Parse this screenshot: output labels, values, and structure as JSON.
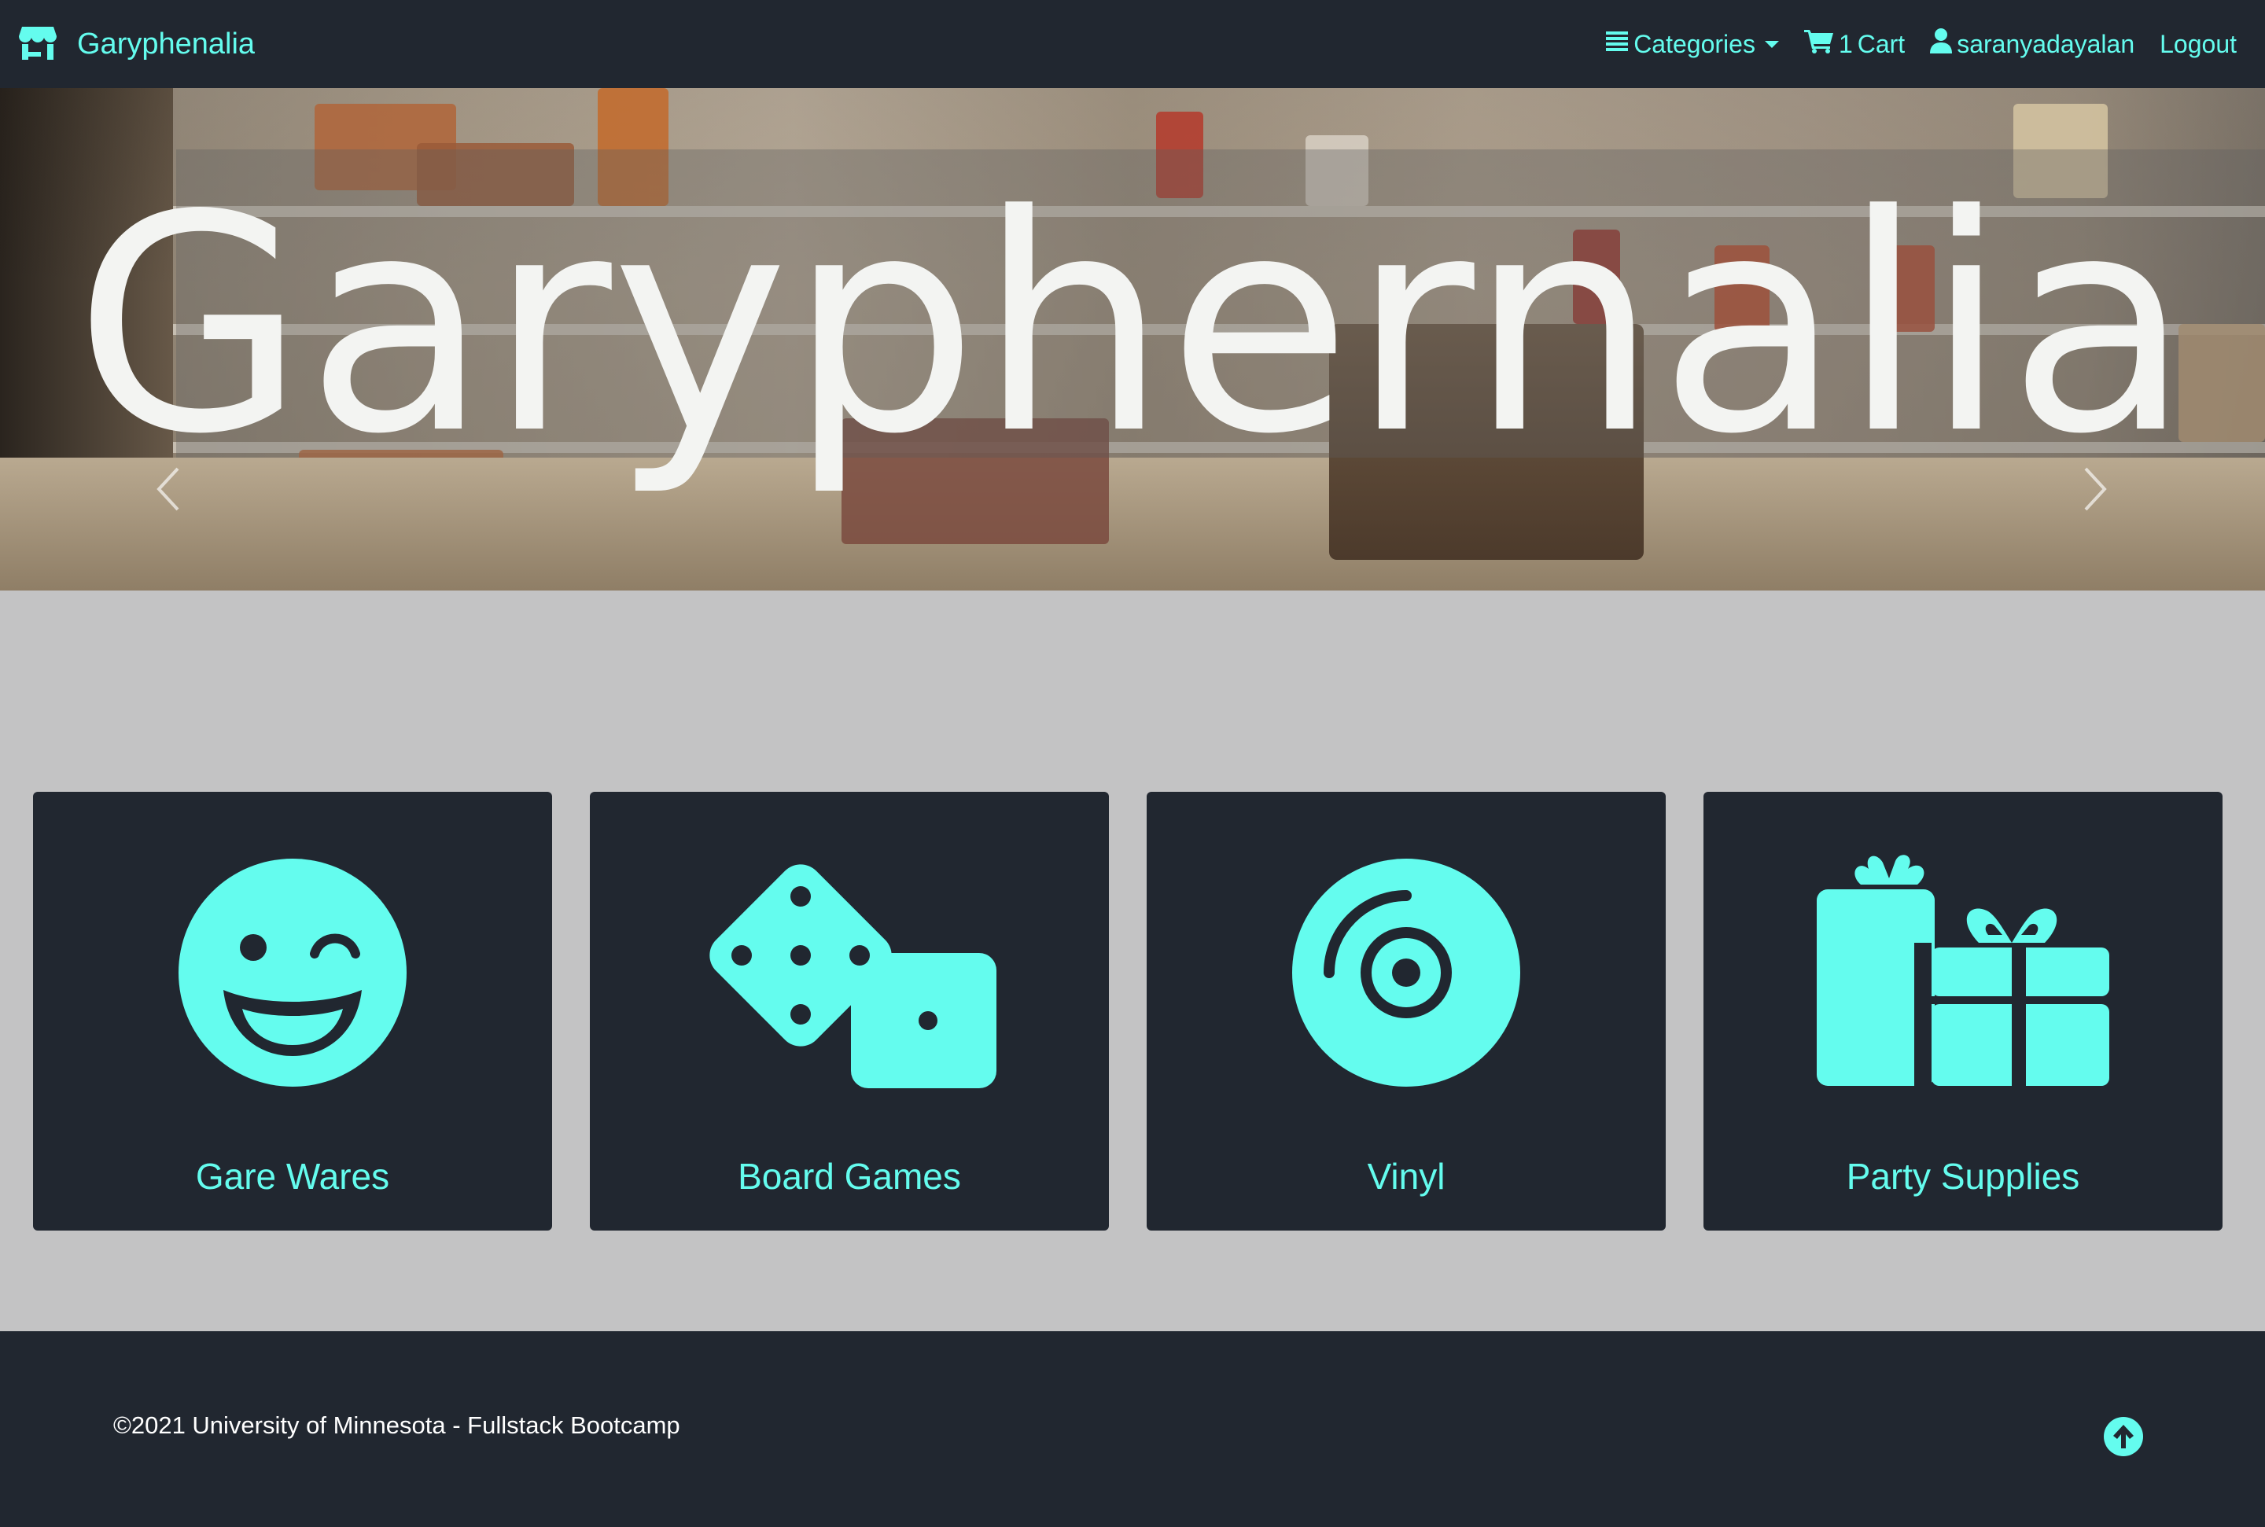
{
  "navbar": {
    "brand": "Garyphenalia",
    "brand_icon": "store-icon",
    "categories": "Categories",
    "cart_count": "1",
    "cart_label": "Cart",
    "username": "saranyadayalan",
    "logout": "Logout"
  },
  "hero": {
    "title": "Garyphernalia"
  },
  "cards": [
    {
      "label": "Gare Wares",
      "icon": "grin-wink-icon"
    },
    {
      "label": "Board Games",
      "icon": "dice-icon"
    },
    {
      "label": "Vinyl",
      "icon": "compact-disc-icon"
    },
    {
      "label": "Party Supplies",
      "icon": "gifts-icon"
    }
  ],
  "footer": {
    "text": "©2021 University of Minnesota - Fullstack Bootcamp"
  },
  "colors": {
    "accent": "#64fcee",
    "navbar_bg": "#212730",
    "page_bg": "#c3c3c4"
  }
}
